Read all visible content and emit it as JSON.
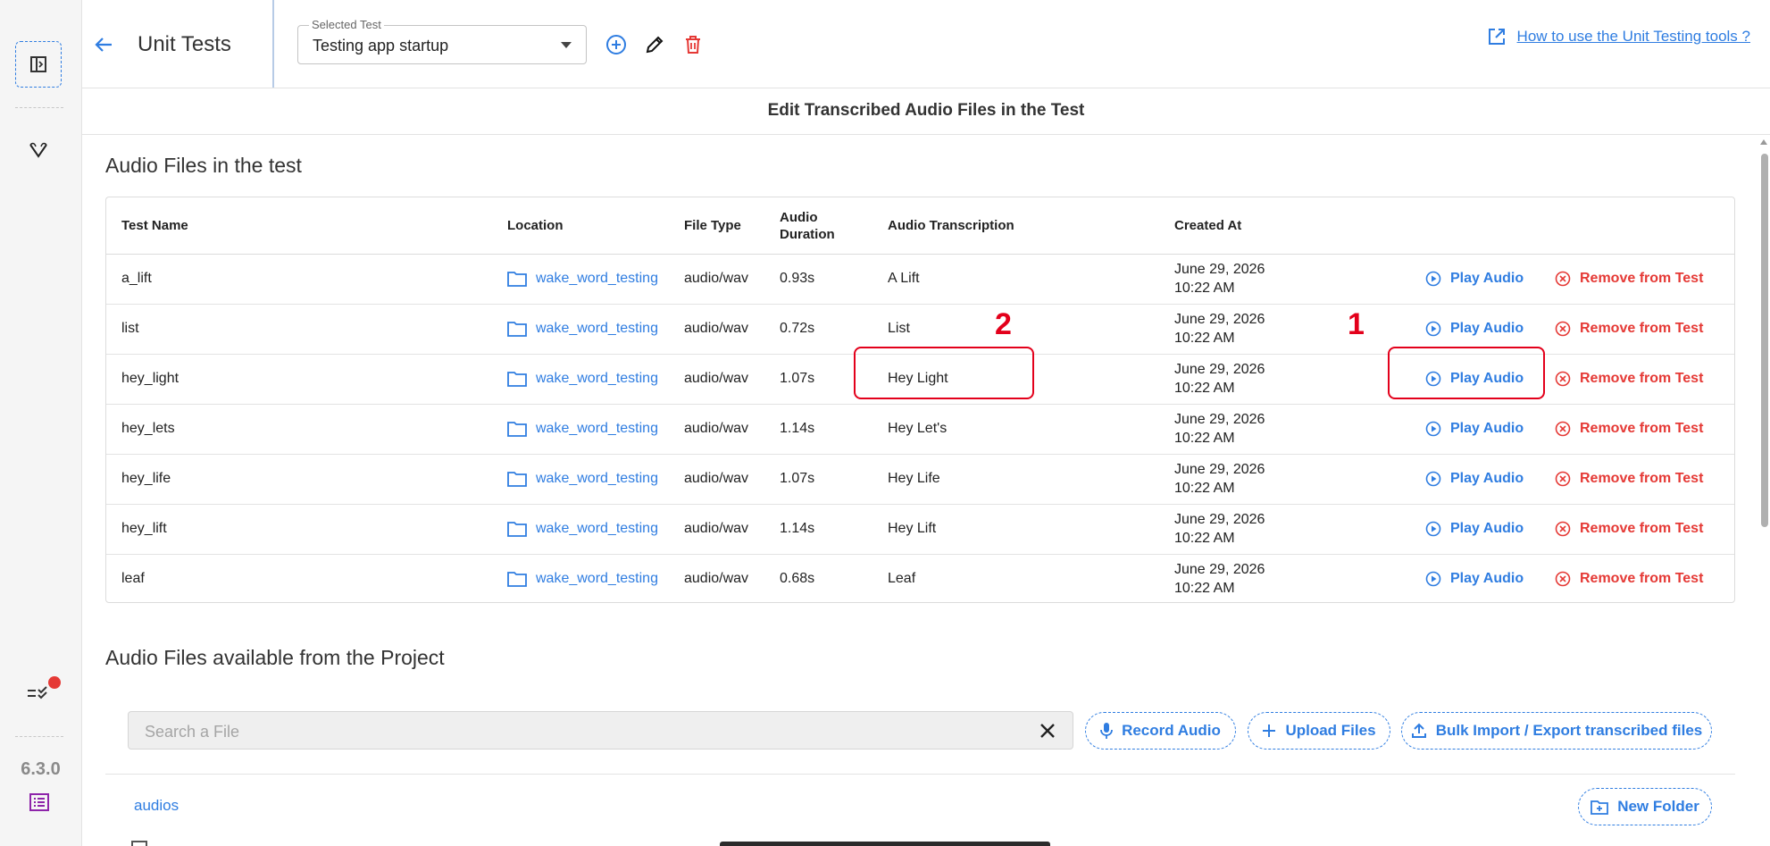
{
  "rail": {
    "version": "6.3.0"
  },
  "topbar": {
    "title": "Unit Tests",
    "selected_test_label": "Selected Test",
    "selected_test_value": "Testing app startup",
    "help_link": "How to use the Unit Testing tools ?"
  },
  "header": {
    "title": "Edit Transcribed Audio Files in the Test"
  },
  "test_files": {
    "title": "Audio Files in the test",
    "columns": {
      "name": "Test Name",
      "location": "Location",
      "type": "File Type",
      "duration_1": "Audio",
      "duration_2": "Duration",
      "transcription": "Audio Transcription",
      "created": "Created At"
    },
    "play_label": "Play Audio",
    "remove_label": "Remove from Test",
    "rows": [
      {
        "name": "a_lift",
        "location": "wake_word_testing",
        "type": "audio/wav",
        "duration": "0.93s",
        "transcription": "A Lift",
        "date": "June 29, 2026",
        "time": "10:22 AM"
      },
      {
        "name": "list",
        "location": "wake_word_testing",
        "type": "audio/wav",
        "duration": "0.72s",
        "transcription": "List",
        "date": "June 29, 2026",
        "time": "10:22 AM"
      },
      {
        "name": "hey_light",
        "location": "wake_word_testing",
        "type": "audio/wav",
        "duration": "1.07s",
        "transcription": "Hey Light",
        "date": "June 29, 2026",
        "time": "10:22 AM"
      },
      {
        "name": "hey_lets",
        "location": "wake_word_testing",
        "type": "audio/wav",
        "duration": "1.14s",
        "transcription": "Hey Let's",
        "date": "June 29, 2026",
        "time": "10:22 AM"
      },
      {
        "name": "hey_life",
        "location": "wake_word_testing",
        "type": "audio/wav",
        "duration": "1.07s",
        "transcription": "Hey Life",
        "date": "June 29, 2026",
        "time": "10:22 AM"
      },
      {
        "name": "hey_lift",
        "location": "wake_word_testing",
        "type": "audio/wav",
        "duration": "1.14s",
        "transcription": "Hey Lift",
        "date": "June 29, 2026",
        "time": "10:22 AM"
      },
      {
        "name": "leaf",
        "location": "wake_word_testing",
        "type": "audio/wav",
        "duration": "0.68s",
        "transcription": "Leaf",
        "date": "June 29, 2026",
        "time": "10:22 AM"
      }
    ]
  },
  "annotations": {
    "label_1": "1",
    "label_2": "2"
  },
  "project_files": {
    "title": "Audio Files available from the Project",
    "search_placeholder": "Search a File",
    "search_value": "",
    "record_label": "Record Audio",
    "upload_label": "Upload Files",
    "bulk_label": "Bulk Import / Export transcribed files",
    "folder_crumb": "audios",
    "new_folder_label": "New Folder"
  },
  "colors": {
    "accent": "#2f7de1",
    "danger": "#e53935",
    "annotation": "#e3001b"
  }
}
